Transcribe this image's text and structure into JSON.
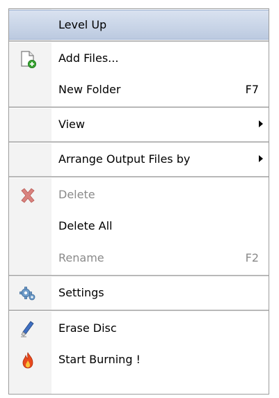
{
  "menu": {
    "items": [
      {
        "label": "Level Up",
        "icon": null,
        "shortcut": "",
        "submenu": false,
        "enabled": true,
        "highlighted": true
      },
      {
        "label": "Add Files...",
        "icon": "add-file-icon",
        "shortcut": "",
        "submenu": false,
        "enabled": true,
        "highlighted": false
      },
      {
        "label": "New Folder",
        "icon": null,
        "shortcut": "F7",
        "submenu": false,
        "enabled": true,
        "highlighted": false
      },
      {
        "label": "View",
        "icon": null,
        "shortcut": "",
        "submenu": true,
        "enabled": true,
        "highlighted": false
      },
      {
        "label": "Arrange Output Files by",
        "icon": null,
        "shortcut": "",
        "submenu": true,
        "enabled": true,
        "highlighted": false
      },
      {
        "label": "Delete",
        "icon": "delete-x-icon",
        "shortcut": "",
        "submenu": false,
        "enabled": false,
        "highlighted": false
      },
      {
        "label": "Delete All",
        "icon": null,
        "shortcut": "",
        "submenu": false,
        "enabled": true,
        "highlighted": false
      },
      {
        "label": "Rename",
        "icon": null,
        "shortcut": "F2",
        "submenu": false,
        "enabled": false,
        "highlighted": false
      },
      {
        "label": "Settings",
        "icon": "gear-icon",
        "shortcut": "",
        "submenu": false,
        "enabled": true,
        "highlighted": false
      },
      {
        "label": "Erase Disc",
        "icon": "eraser-icon",
        "shortcut": "",
        "submenu": false,
        "enabled": true,
        "highlighted": false
      },
      {
        "label": "Start Burning !",
        "icon": "flame-icon",
        "shortcut": "",
        "submenu": false,
        "enabled": true,
        "highlighted": false
      }
    ]
  },
  "colors": {
    "highlight": "#c7d3e8",
    "disabled_text": "#8a8a8a",
    "gutter": "#f3f3f3",
    "separator": "#b8b8b8"
  }
}
